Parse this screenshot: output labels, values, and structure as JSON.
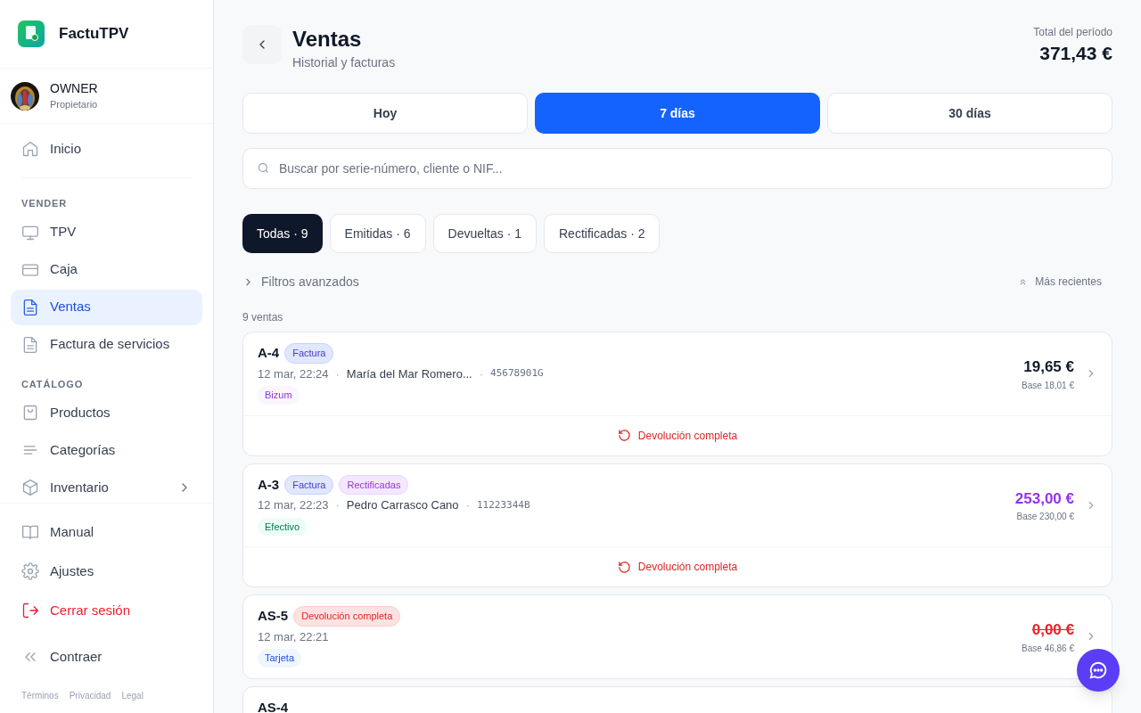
{
  "app": {
    "name": "FactuTPV"
  },
  "user": {
    "name": "OWNER",
    "role": "Propietario"
  },
  "nav_top": [
    {
      "label": "Inicio",
      "selected": false,
      "submenu": false
    }
  ],
  "nav_sections": [
    {
      "title": "VENDER",
      "items": [
        {
          "label": "TPV",
          "selected": false,
          "submenu": false
        },
        {
          "label": "Caja",
          "selected": false,
          "submenu": false
        },
        {
          "label": "Ventas",
          "selected": true,
          "submenu": false
        },
        {
          "label": "Factura de servicios",
          "selected": false,
          "submenu": false
        }
      ]
    },
    {
      "title": "CATÁLOGO",
      "items": [
        {
          "label": "Productos",
          "selected": false,
          "submenu": false
        },
        {
          "label": "Categorías",
          "selected": false,
          "submenu": false
        },
        {
          "label": "Inventario",
          "selected": false,
          "submenu": true
        }
      ]
    }
  ],
  "nav_bottom": [
    {
      "label": "Manual",
      "kind": "normal"
    },
    {
      "label": "Ajustes",
      "kind": "normal"
    },
    {
      "label": "Cerrar sesión",
      "kind": "danger"
    },
    {
      "label": "Contraer",
      "kind": "normal"
    }
  ],
  "footer_links": [
    "Términos",
    "Privacidad",
    "Legal"
  ],
  "header": {
    "title": "Ventas",
    "subtitle": "Historial y facturas",
    "total_label": "Total del período",
    "total": "371,43 €"
  },
  "periods": [
    {
      "label": "Hoy",
      "selected": false
    },
    {
      "label": "7 días",
      "selected": true
    },
    {
      "label": "30 días",
      "selected": false
    }
  ],
  "search": {
    "placeholder": "Buscar por serie-número, cliente o NIF..."
  },
  "filters": [
    {
      "label": "Todas · 9",
      "selected": true
    },
    {
      "label": "Emitidas · 6",
      "selected": false
    },
    {
      "label": "Devueltas · 1",
      "selected": false
    },
    {
      "label": "Rectificadas · 2",
      "selected": false
    }
  ],
  "advanced_filters": "Filtros avanzados",
  "sort": "Más recientes",
  "count": "9 ventas",
  "sales": [
    {
      "number": "A-4",
      "kind": "normal",
      "tags": [
        {
          "label": "Factura",
          "kind": "invoice"
        }
      ],
      "meta": [
        {
          "text": "12 mar, 22:24",
          "kind": "date"
        },
        {
          "text": "·",
          "kind": "separator"
        },
        {
          "text": "María del Mar Romero...",
          "kind": "customer"
        },
        {
          "text": "·",
          "kind": "separator"
        },
        {
          "text": "45678901G",
          "kind": "nif"
        }
      ],
      "payment": {
        "label": "Bizum",
        "kind": "bizum"
      },
      "amount": "19,65 €",
      "base": "Base 18,01 €",
      "footer": "Devolución completa"
    },
    {
      "number": "A-3",
      "kind": "rectified",
      "tags": [
        {
          "label": "Factura",
          "kind": "invoice"
        },
        {
          "label": "Rectificadas",
          "kind": "rectified"
        }
      ],
      "meta": [
        {
          "text": "12 mar, 22:23",
          "kind": "date"
        },
        {
          "text": "·",
          "kind": "separator"
        },
        {
          "text": "Pedro Carrasco Cano",
          "kind": "customer"
        },
        {
          "text": "·",
          "kind": "separator"
        },
        {
          "text": "11223344B",
          "kind": "nif"
        }
      ],
      "payment": {
        "label": "Efectivo",
        "kind": "cash"
      },
      "amount": "253,00 €",
      "base": "Base 230,00 €",
      "footer": "Devolución completa"
    },
    {
      "number": "AS-5",
      "kind": "voided",
      "tags": [
        {
          "label": "Devolución completa",
          "kind": "refund"
        }
      ],
      "meta": [
        {
          "text": "12 mar, 22:21",
          "kind": "date"
        }
      ],
      "payment": {
        "label": "Tarjeta",
        "kind": "card"
      },
      "amount": "0,00 €",
      "base": "Base 46,86 €"
    },
    {
      "number": "AS-4"
    }
  ]
}
